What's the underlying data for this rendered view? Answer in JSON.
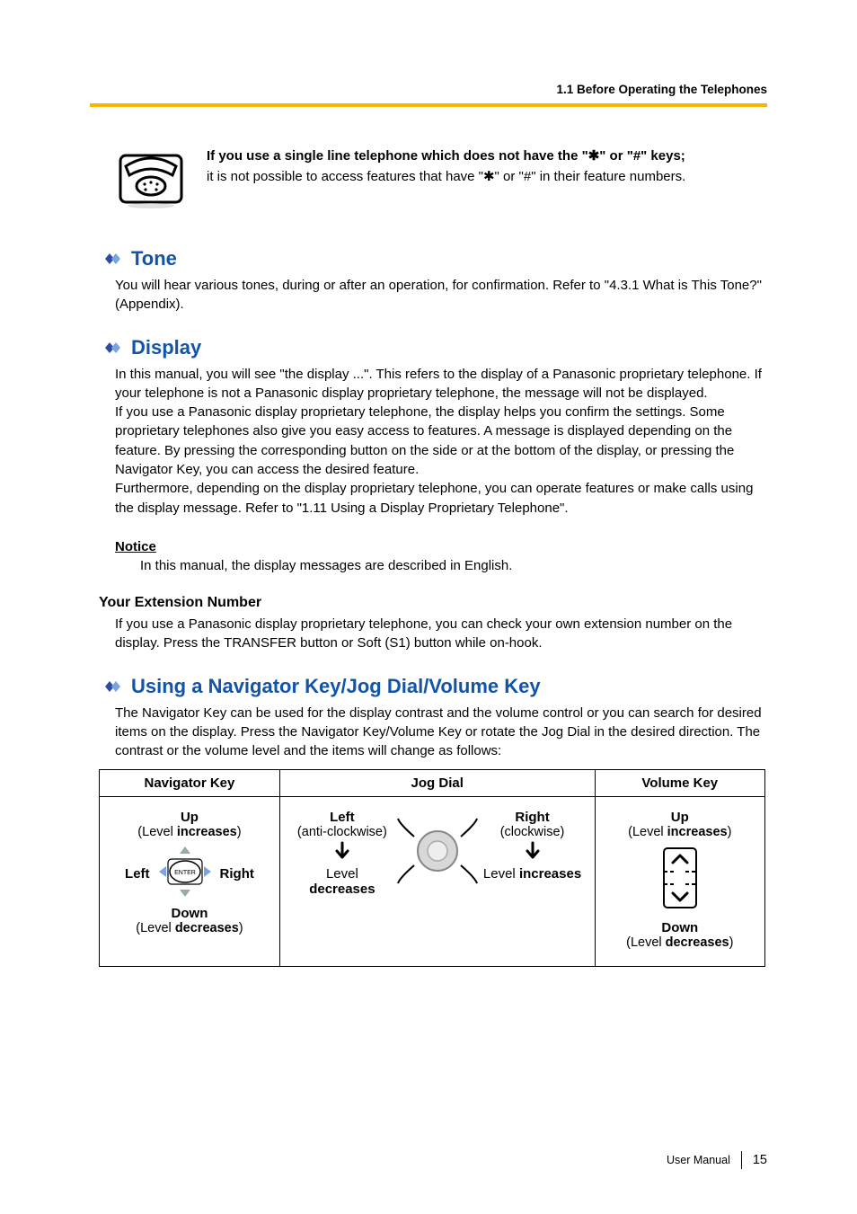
{
  "running_head": "1.1 Before Operating the Telephones",
  "intro": {
    "bold_line": "If you use a single line telephone which does not have the \"✱\" or \"#\" keys;",
    "plain_line": "it is not possible to access features that have \"✱\" or \"#\" in their feature numbers."
  },
  "sections": {
    "tone": {
      "title": "Tone",
      "body": "You will hear various tones, during or after an operation, for confirmation. Refer to \"4.3.1 What is This Tone?\" (Appendix)."
    },
    "display": {
      "title": "Display",
      "body": "In this manual, you will see \"the display ...\". This refers to the display of a Panasonic proprietary telephone. If your telephone is not a Panasonic display proprietary telephone, the message will not be displayed.\nIf you use a Panasonic display proprietary telephone, the display helps you confirm the settings. Some proprietary telephones also give you easy access to features. A message is displayed depending on the feature. By pressing the corresponding button on the side or at the bottom of the display, or pressing the Navigator Key, you can access the desired feature.\nFurthermore, depending on the display proprietary telephone, you can operate features or make calls using the display message. Refer to \"1.11 Using a Display Proprietary Telephone\".",
      "notice_label": "Notice",
      "notice_body": "In this manual, the display messages are described in English.",
      "ext_head": "Your Extension Number",
      "ext_body": "If you use a Panasonic display proprietary telephone, you can check your own extension number on the display. Press the TRANSFER button or Soft (S1) button while on-hook."
    },
    "navkey": {
      "title": "Using a Navigator Key/Jog Dial/Volume Key",
      "body": "The Navigator Key can be used for the display contrast and the volume control or you can search for desired items on the display. Press the Navigator Key/Volume Key or rotate the Jog Dial in the desired direction. The contrast or the volume level and the items will change as follows:"
    }
  },
  "chart_data": {
    "type": "table",
    "title": "Navigator Key / Jog Dial / Volume Key behaviour",
    "columns": [
      "Navigator Key",
      "Jog Dial",
      "Volume Key"
    ],
    "rows": [
      {
        "navigator_key": {
          "up": {
            "label": "Up",
            "effect": "Level increases"
          },
          "down": {
            "label": "Down",
            "effect": "Level decreases"
          },
          "left": {
            "label": "Left"
          },
          "right": {
            "label": "Right"
          },
          "center": {
            "label": "ENTER"
          }
        },
        "jog_dial": {
          "left": {
            "label": "Left",
            "direction": "anti-clockwise",
            "effect": "Level decreases"
          },
          "right": {
            "label": "Right",
            "direction": "clockwise",
            "effect": "Level increases"
          }
        },
        "volume_key": {
          "up": {
            "label": "Up",
            "effect": "Level increases"
          },
          "down": {
            "label": "Down",
            "effect": "Level decreases"
          }
        }
      }
    ]
  },
  "footer": {
    "doc": "User Manual",
    "page": "15"
  }
}
